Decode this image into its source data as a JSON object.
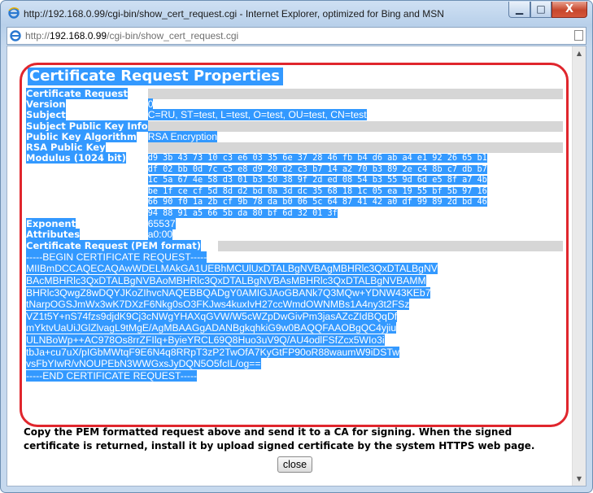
{
  "window": {
    "title": "http://192.168.0.99/cgi-bin/show_cert_request.cgi - Internet Explorer, optimized for Bing and MSN",
    "controls": {
      "minimize": "▁",
      "maximize": "□",
      "close": "X"
    }
  },
  "address_bar": {
    "prefix": "http://",
    "host": "192.168.0.99",
    "path": "/cgi-bin/show_cert_request.cgi"
  },
  "page": {
    "heading": "Certificate Request Properties",
    "rows": {
      "certificate_request": {
        "label": "Certificate Request"
      },
      "version": {
        "label": "Version",
        "value": "0"
      },
      "subject": {
        "label": "Subject",
        "value": "C=RU, ST=test, L=test, O=test, OU=test, CN=test"
      },
      "subject_pki": {
        "label": "Subject Public Key Info"
      },
      "pk_algorithm": {
        "label": "Public Key Algorithm",
        "value": "RSA Encryption"
      },
      "rsa_public_key": {
        "label": "RSA Public Key"
      },
      "modulus": {
        "label": "Modulus (1024 bit)",
        "lines": [
          "d9 3b 43 73 10 c3 e6 03 35 6e 37 28 46 fb b4 d6 ab a4 e1 92 26 65 b1",
          "df 02 bb 0d 7c c5 e8 d9 20 d2 c3 b7 14 a2 70 b3 89 2e c4 8b c7 db b7",
          "1c 5a 67 4e 58 d3 01 b3 50 38 9f 2d ed 08 54 b3 55 9d 6d e5 8f a7 4b",
          "be 1f ce cf 5d 8d d2 bd 0a 3d dc 35 68 18 1c 05 ea 19 55 bf 5b 97 16",
          "66 90 f0 1a 2b cf 9b 78 da b0 06 5c 64 87 41 42 a0 df 99 89 2d bd 46",
          "94 88 91 a5 66 5b da 80 bf 6d 32 01 3f"
        ]
      },
      "exponent": {
        "label": "Exponent",
        "value": "65537"
      },
      "attributes": {
        "label": "Attributes",
        "value": "a0:00"
      },
      "pem": {
        "label": "Certificate Request (PEM format)",
        "lines": [
          "-----BEGIN CERTIFICATE REQUEST-----",
          "MIIBmDCCAQECAQAwWDELMAkGA1UEBhMCUlUxDTALBgNVBAgMBHRlc3QxDTALBgNV",
          "BAcMBHRlc3QxDTALBgNVBAoMBHRlc3QxDTALBgNVBAsMBHRlc3QxDTALBgNVBAMM",
          "BHRlc3QwgZ8wDQYJKoZIhvcNAQEBBQADgY0AMIGJAoGBANk7Q3MQw+YDNW43KEb7",
          "tNarpOGSJmWx3wK7DXzF6Nkg0sO3FKJws4kuxIvH27ccWmdOWNMBs1A4ny3t2FSz",
          "VZ1t5Y+nS74fzs9djdK9Cj3cNWgYHAXqGVW/W5cWZpDwGivPm3jasAZcZIdBQqDf",
          "mYktvUaUiJGlZlvagL9tMgE/AgMBAAGgADANBgkqhkiG9w0BAQQFAAOBgQC4yjiu",
          "ULNBoWp++AC978Os8rrZFIlq+ByieYRCL69Q8Huo3uV9Q/AU4odlFSfZcx5WIo3i",
          "tbJa+cu7uX/pIGbMWtqF9E6N4q8RRpT3zP2TwOfA7KyGtFP90oR88waumW9iDSTw",
          "vsFbYIwR/vNOUPEbN3WWGxsJyDQN5O5fcIL/og==",
          "-----END CERTIFICATE REQUEST-----"
        ]
      }
    },
    "instructions": "Copy the PEM formatted request above and send it to a CA for signing. When the signed certificate is returned, install it by upload signed certificate by the system HTTPS web page.",
    "close_label": "close"
  },
  "colors": {
    "selection": "#3399ff",
    "highlight_outline": "#e0262d",
    "label_row_fill": "#d6d6d6"
  }
}
